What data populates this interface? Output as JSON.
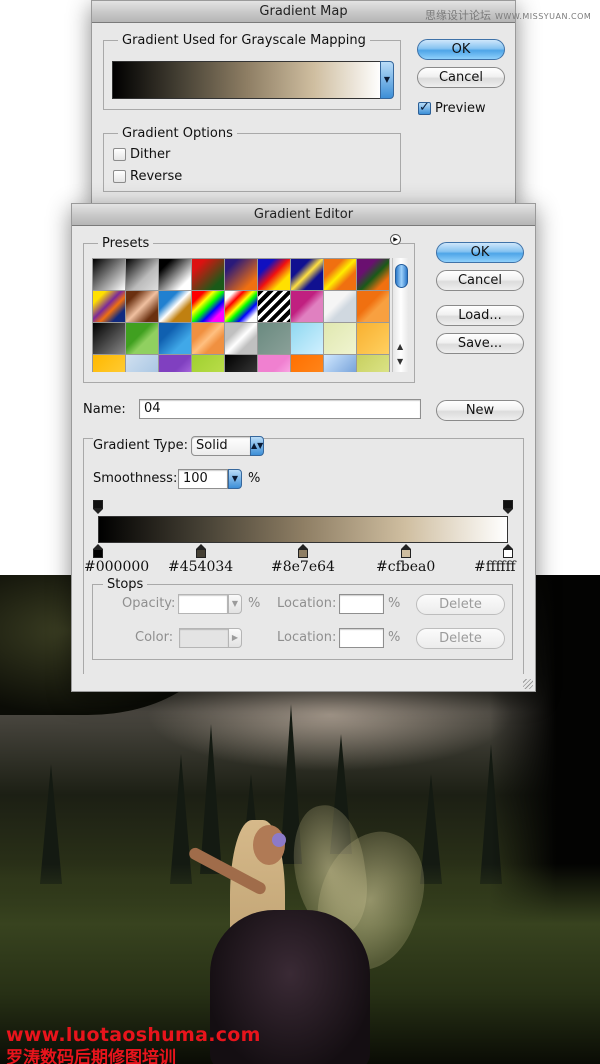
{
  "watermark_top": {
    "cn": "思缘设计论坛",
    "url": "WWW.MISSYUAN.COM"
  },
  "gradient_map": {
    "title": "Gradient Map",
    "group_label": "Gradient Used for Grayscale Mapping",
    "ok_label": "OK",
    "cancel_label": "Cancel",
    "preview_label": "Preview",
    "preview_checked": true,
    "options_label": "Gradient Options",
    "dither_label": "Dither",
    "dither_checked": false,
    "reverse_label": "Reverse",
    "reverse_checked": false
  },
  "gradient_editor": {
    "title": "Gradient Editor",
    "presets_label": "Presets",
    "ok_label": "OK",
    "cancel_label": "Cancel",
    "load_label": "Load...",
    "save_label": "Save...",
    "name_label": "Name:",
    "name_value": "04",
    "new_label": "New",
    "gradient_type_label": "Gradient Type:",
    "gradient_type_value": "Solid",
    "smoothness_label": "Smoothness:",
    "smoothness_value": "100",
    "percent": "%",
    "color_stops": [
      {
        "hex": "#000000",
        "label": "#000000",
        "location": 0
      },
      {
        "hex": "#454034",
        "label": "#454034",
        "location": 25
      },
      {
        "hex": "#8e7e64",
        "label": "#8e7e64",
        "location": 50
      },
      {
        "hex": "#cfbea0",
        "label": "#cfbea0",
        "location": 75
      },
      {
        "hex": "#ffffff",
        "label": "#ffffff",
        "location": 100
      }
    ],
    "opacity_stops": [
      {
        "location": 0
      },
      {
        "location": 100
      }
    ],
    "stops": {
      "label": "Stops",
      "opacity_label": "Opacity:",
      "opacity_value": "",
      "color_label": "Color:",
      "location_label": "Location:",
      "location_value_1": "",
      "location_value_2": "",
      "delete_label": "Delete"
    },
    "presets": [
      "linear-gradient(135deg,#000,#fff)",
      "linear-gradient(135deg,#000,#bbb 60%,#ddd)",
      "linear-gradient(135deg,#000 20%,#fff 80%)",
      "linear-gradient(135deg,#d11 20%,#1a5a18 80%)",
      "linear-gradient(135deg,#2a1a7a 20%,#f07010 80%)",
      "linear-gradient(135deg,#1010c0 25%,#f01010 50%,#ffe000 75%)",
      "linear-gradient(135deg,#101090 30%,#ffe040 50%,#101090 70%)",
      "linear-gradient(135deg,#f07010 30%,#ffee00 50%,#f07010 70%)",
      "linear-gradient(135deg,#6a1070 30%,#1a5a18 55%,#f07010 80%)",
      "linear-gradient(135deg,#ffe000 20%,#7a2a9a 45%,#f07010 60%,#102a80 80%)",
      "linear-gradient(135deg,#6a3010 20%,#f0c0a0 50%,#6a3010 80%)",
      "linear-gradient(135deg,#2080d0 30%,#fff 50%,#c08010 70%)",
      "linear-gradient(135deg,#f00 20%,#ff0 35%,#0f0 50%,#00f 65%,#f0f 80%)",
      "linear-gradient(135deg,#fff 15%,#f00 30%,#ff0 45%,#0f0 55%,#00f 70%,#fff 85%)",
      "repeating-linear-gradient(135deg,#000 0 4px,#fff 4px 7px)",
      "linear-gradient(135deg,#c02080 40%,#e080c0 60%)",
      "linear-gradient(135deg,#f5f5f5 40%,#d0d8e0 60%)",
      "linear-gradient(135deg,#f07010 40%,#f8a040 60%)",
      "linear-gradient(135deg,#000,#888)",
      "linear-gradient(135deg,#40a020 40%,#90d060 60%)",
      "linear-gradient(135deg,#1060b0 30%,#40a8e8 70%)",
      "linear-gradient(135deg,#f09040 30%,#ffc080 50%,#f09040 70%)",
      "linear-gradient(135deg,#c0c0c0 30%,#fff 50%,#c0c0c0 70%)",
      "linear-gradient(135deg,#6a8a80,#8aa098)",
      "linear-gradient(135deg,#90d8f0,#d0f0ff)",
      "linear-gradient(135deg,#e0e8b0,#f0f4d0)",
      "linear-gradient(135deg,#f8b030,#ffd060)",
      "linear-gradient(135deg,#ffb800,#ffd040)",
      "linear-gradient(135deg,#d0e0f0,#a0c0e0)",
      "linear-gradient(135deg,#8040c0 50%,#c080f0)",
      "linear-gradient(135deg,#a0d030,#c0e050)",
      "linear-gradient(135deg,#000,#444)",
      "linear-gradient(135deg,#f080d0 50%,#ffc0f0)",
      "linear-gradient(135deg,#ff7000,#ff8a20)",
      "linear-gradient(135deg,#d0e8ff,#6090d0)",
      "linear-gradient(135deg,#c8d060,#e0e890)"
    ]
  },
  "photo_watermark": {
    "url": "www.luotaoshuma.com",
    "cn": "罗涛数码后期修图培训"
  }
}
